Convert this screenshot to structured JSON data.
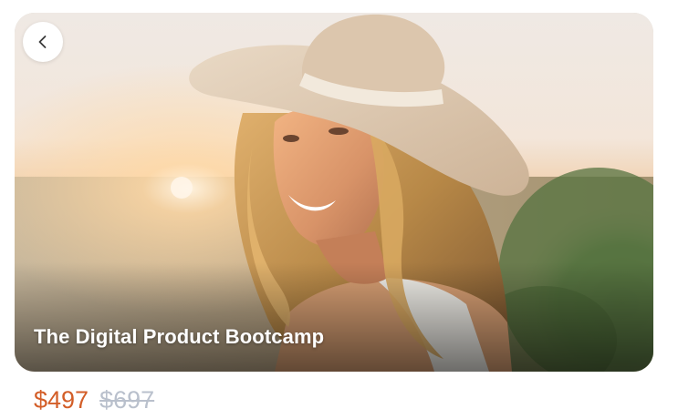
{
  "product": {
    "title": "The Digital Product Bootcamp",
    "price_current": "$497",
    "price_original": "$697"
  },
  "icons": {
    "back": "chevron-left-icon"
  },
  "colors": {
    "price_current": "#d35e28",
    "price_original": "#b9c0cc",
    "title_text": "#ffffff",
    "back_button_bg": "#ffffff"
  }
}
